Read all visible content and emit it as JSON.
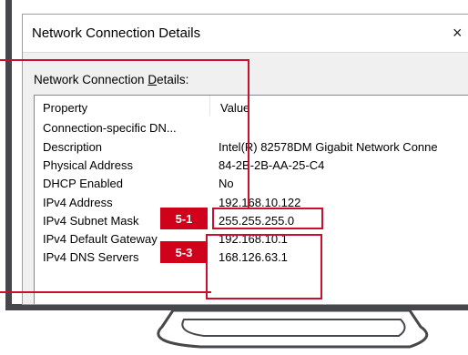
{
  "window": {
    "title": "Network Connection Details",
    "close_glyph": "×"
  },
  "section": {
    "label_prefix": "Network Connection ",
    "label_mnemonic": "D",
    "label_suffix": "etails:"
  },
  "table": {
    "headers": {
      "property": "Property",
      "value": "Value"
    },
    "rows": [
      {
        "property": "Connection-specific DN...",
        "value": ""
      },
      {
        "property": "Description",
        "value": "Intel(R) 82578DM Gigabit Network Conne"
      },
      {
        "property": "Physical Address",
        "value": "84-2B-2B-AA-25-C4"
      },
      {
        "property": "DHCP Enabled",
        "value": "No"
      },
      {
        "property": "IPv4 Address",
        "value": "192.168.10.122"
      },
      {
        "property": "IPv4 Subnet Mask",
        "value": "255.255.255.0"
      },
      {
        "property": "IPv4 Default Gateway",
        "value": "192.168.10.1"
      },
      {
        "property": "IPv4 DNS Servers",
        "value": "168.126.63.1"
      }
    ]
  },
  "annotations": {
    "tag_1": "5-1",
    "tag_2": "5-3",
    "color": "#d0021b"
  }
}
